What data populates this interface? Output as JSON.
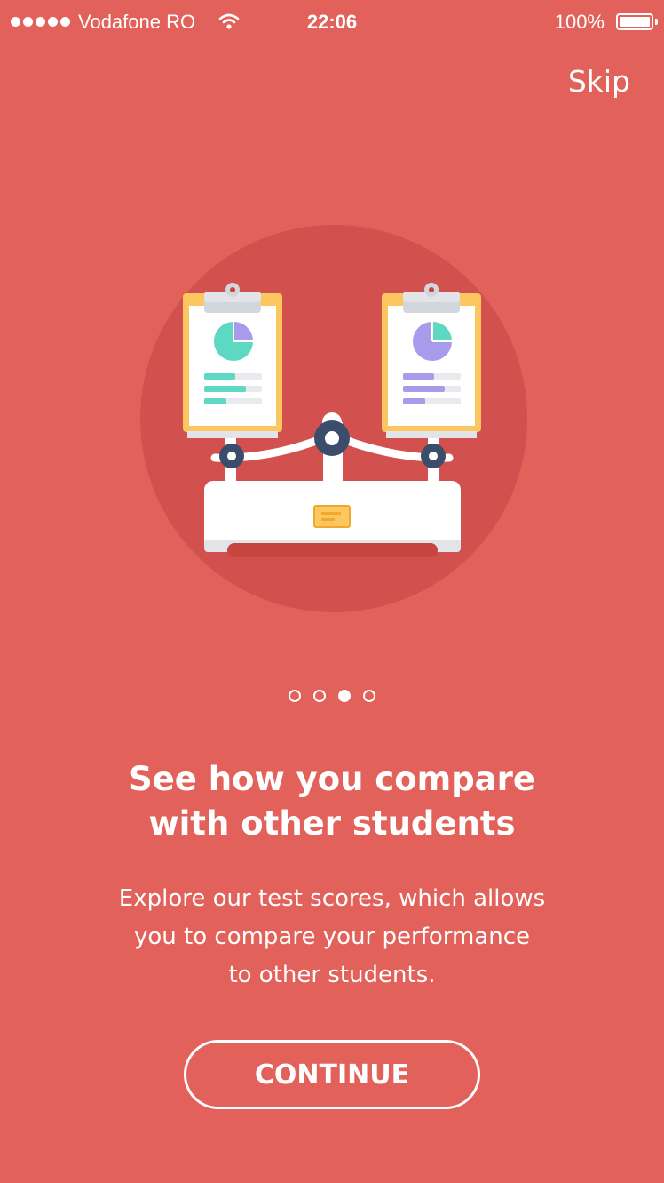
{
  "status_bar": {
    "carrier": "Vodafone RO",
    "time": "22:06",
    "battery": "100%"
  },
  "header": {
    "skip_label": "Skip"
  },
  "illustration": {
    "icon": "balance-scale-with-clipboards-icon",
    "colors": {
      "circle": "#D2504D",
      "clipboard": "#FDC75F",
      "teal": "#5CD8C3",
      "purple": "#A99BEB",
      "navy": "#3A4E6C"
    }
  },
  "pager": {
    "total": 4,
    "active_index": 2
  },
  "onboarding": {
    "title_line1": "See how you compare",
    "title_line2": "with other students",
    "description_line1": "Explore our test scores, which allows",
    "description_line2": "you to compare your performance",
    "description_line3": "to other students."
  },
  "cta": {
    "continue_label": "CONTINUE"
  },
  "theme": {
    "background": "#E2625B"
  }
}
